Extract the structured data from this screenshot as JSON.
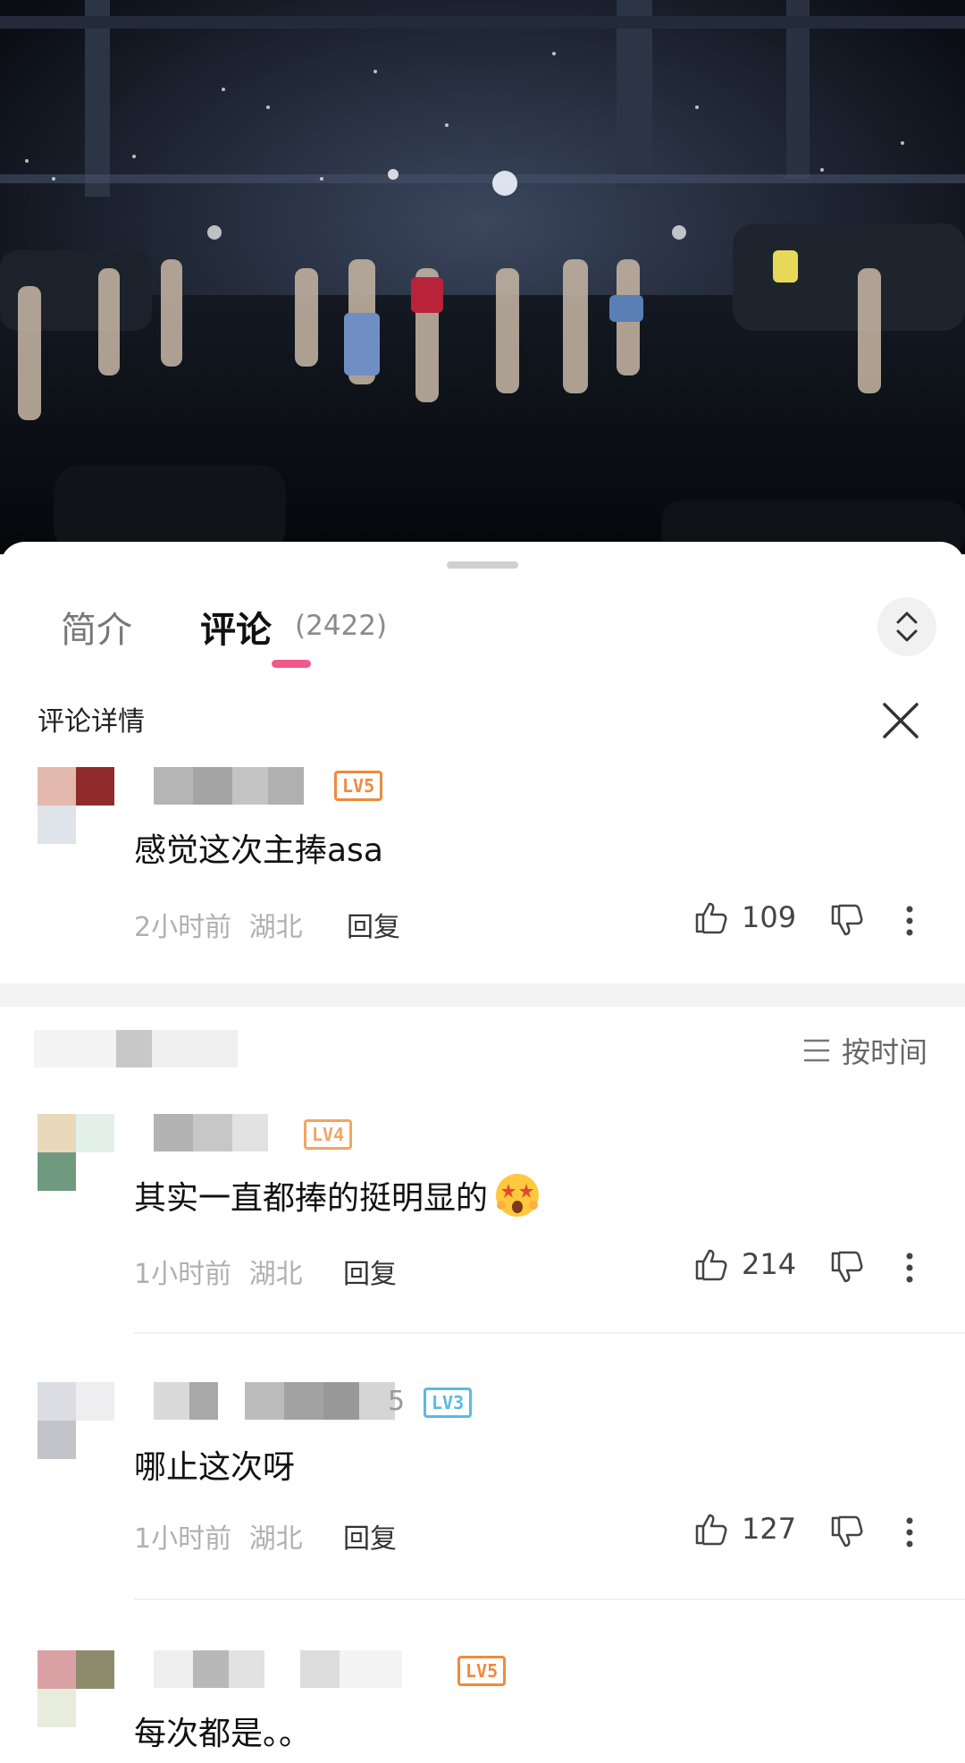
{
  "tabs": {
    "intro_label": "简介",
    "comments_label": "评论",
    "comments_count": "(2422)"
  },
  "detail": {
    "title": "评论详情"
  },
  "sort": {
    "label": "按时间"
  },
  "top_comment": {
    "level": "LV5",
    "level_color": "#f08a3c",
    "text": "感觉这次主捧asa",
    "time": "2小时前",
    "location": "湖北",
    "reply_label": "回复",
    "likes": "109"
  },
  "replies": [
    {
      "level": "LV4",
      "level_color": "#f4a460",
      "text": "其实一直都捧的挺明显的",
      "emoji": "star-eyes-emoji",
      "time": "1小时前",
      "location": "湖北",
      "reply_label": "回复",
      "likes": "214"
    },
    {
      "name_suffix": "5",
      "level": "LV3",
      "level_color": "#5bb8e8",
      "text": "哪止这次呀",
      "time": "1小时前",
      "location": "湖北",
      "reply_label": "回复",
      "likes": "127"
    },
    {
      "level": "LV5",
      "level_color": "#f08a3c",
      "text": "每次都是。。"
    }
  ]
}
